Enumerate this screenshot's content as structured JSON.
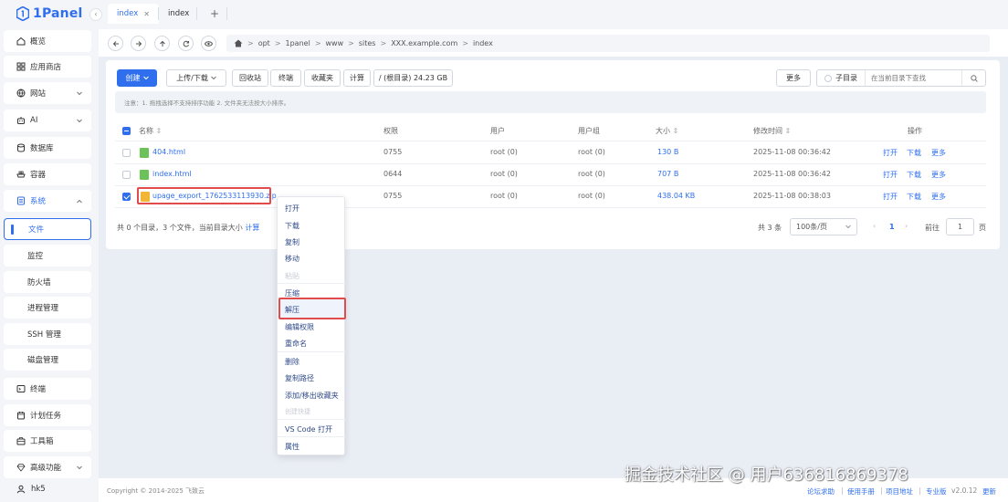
{
  "app": {
    "logo_text": "1Panel",
    "brand_color": "#2f6fed",
    "danger_color": "#e24b4b"
  },
  "sidebar": {
    "items": [
      {
        "label": "概览",
        "icon": "home-icon"
      },
      {
        "label": "应用商店",
        "icon": "apps-icon"
      },
      {
        "label": "网站",
        "icon": "globe-icon"
      },
      {
        "label": "AI",
        "icon": "robot-icon"
      },
      {
        "label": "数据库",
        "icon": "database-icon"
      },
      {
        "label": "容器",
        "icon": "container-icon"
      },
      {
        "label": "系统",
        "icon": "system-icon"
      }
    ],
    "sub_items": [
      {
        "label": "文件"
      },
      {
        "label": "监控"
      },
      {
        "label": "防火墙"
      },
      {
        "label": "进程管理"
      },
      {
        "label": "SSH 管理"
      },
      {
        "label": "磁盘管理"
      }
    ],
    "bottom_items": [
      {
        "label": "终端",
        "icon": "terminal-icon"
      },
      {
        "label": "计划任务",
        "icon": "calendar-icon"
      },
      {
        "label": "工具箱",
        "icon": "toolbox-icon"
      },
      {
        "label": "高级功能",
        "icon": "diamond-icon"
      }
    ],
    "user": "hk5"
  },
  "tabs": [
    {
      "label": "index"
    },
    {
      "label": "index"
    }
  ],
  "tab_add": "+",
  "path": [
    "opt",
    "1panel",
    "www",
    "sites",
    "XXX.example.com",
    "index"
  ],
  "toolbar": {
    "create": "创建",
    "upload": "上传/下载",
    "recycle": "回收站",
    "terminal": "终端",
    "favorites": "收藏夹",
    "calc": "计算",
    "disk": "/ (根目录) 24.23 GB",
    "more": "更多",
    "subdir": "子目录",
    "search_placeholder": "在当前目录下查找"
  },
  "notice": "注意：1. 拖拽选择不支持排序功能 2. 文件夹无法按大小排序。",
  "table": {
    "headers": [
      "名称",
      "权限",
      "用户",
      "用户组",
      "大小",
      "修改时间",
      "操作"
    ],
    "rows": [
      {
        "name": "404.html",
        "perm": "0755",
        "user": "root (0)",
        "group": "root (0)",
        "size": "130 B",
        "mtime": "2025-11-08 00:36:42",
        "selected": false,
        "icon": "html-file-icon"
      },
      {
        "name": "index.html",
        "perm": "0644",
        "user": "root (0)",
        "group": "root (0)",
        "size": "707 B",
        "mtime": "2025-11-08 00:36:42",
        "selected": false,
        "icon": "html-file-icon"
      },
      {
        "name": "upage_export_1762533113930.zip",
        "perm": "0755",
        "user": "root (0)",
        "group": "root (0)",
        "size": "438.04 KB",
        "mtime": "2025-11-08 00:38:03",
        "selected": true,
        "icon": "zip-file-icon"
      }
    ],
    "actions": [
      "打开",
      "下载",
      "更多"
    ]
  },
  "summary": {
    "text": "共 0 个目录，3 个文件，当前目录大小",
    "calc_link": "计算"
  },
  "pager": {
    "total": "共 3 条",
    "page_size": "100条/页",
    "current": "1",
    "goto_label": "前往",
    "goto_value": "1",
    "page_unit": "页"
  },
  "context_menu": {
    "items": [
      "打开",
      "下载",
      "复制",
      "移动",
      "粘贴",
      "压缩",
      "解压",
      "编辑权限",
      "重命名",
      "删除",
      "复制路径",
      "添加/移出收藏夹",
      "创建快捷",
      "VS Code 打开",
      "属性"
    ],
    "disabled": [
      "粘贴",
      "创建快捷"
    ]
  },
  "footer": {
    "copyright": "Copyright © 2014-2025 飞致云",
    "links": [
      "论坛求助",
      "使用手册",
      "项目地址",
      "专业版"
    ],
    "version": "v2.0.12",
    "update": "更新"
  },
  "watermark": "掘金技术社区 @ 用户636816869378"
}
